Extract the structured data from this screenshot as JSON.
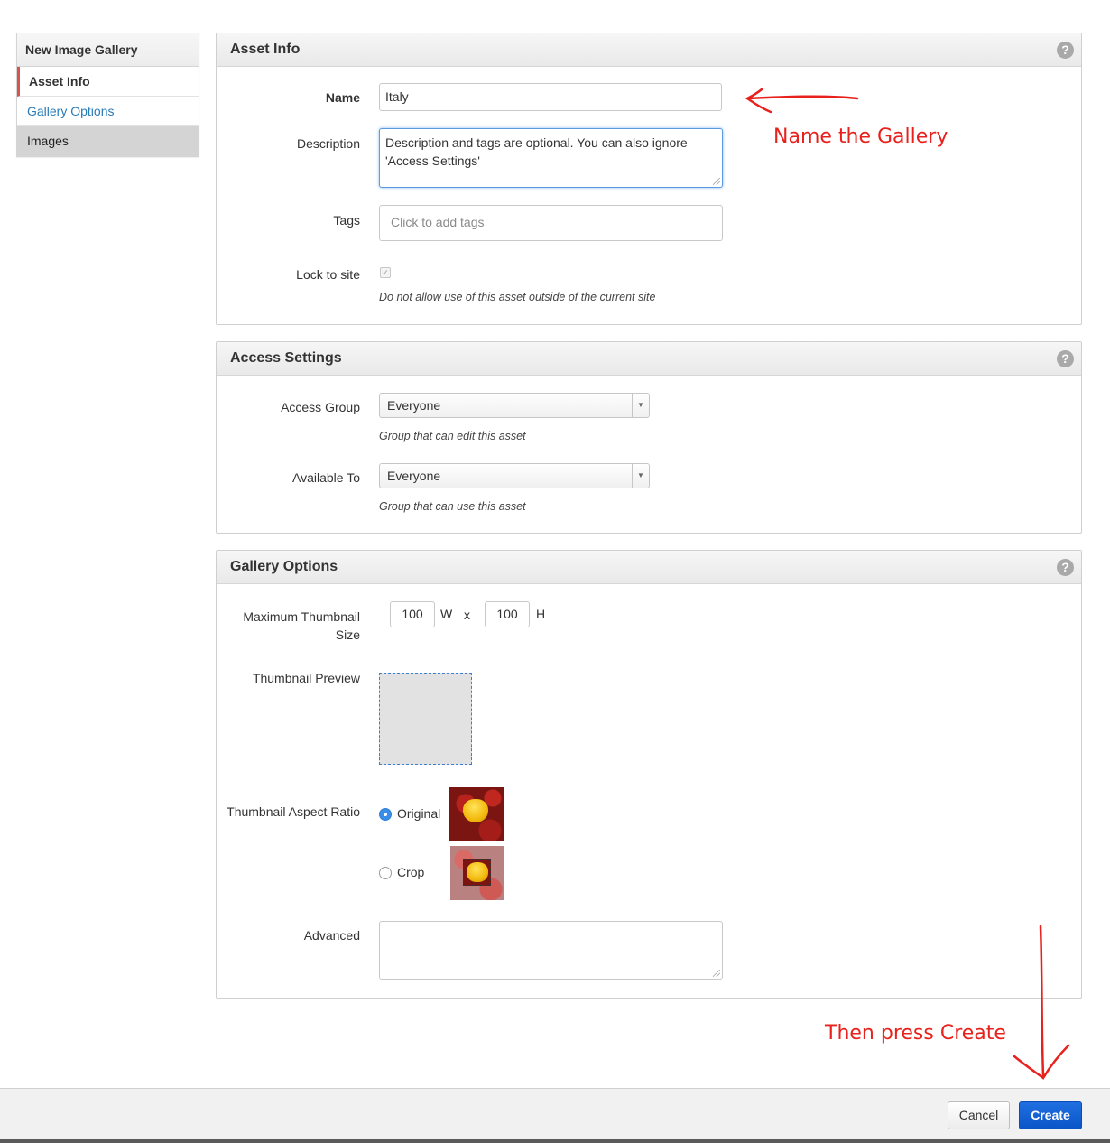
{
  "sidebar": {
    "title": "New Image Gallery",
    "items": [
      {
        "label": "Asset Info"
      },
      {
        "label": "Gallery Options"
      },
      {
        "label": "Images"
      }
    ]
  },
  "asset_info": {
    "title": "Asset Info",
    "help": "?",
    "name_label": "Name",
    "name_value": "Italy",
    "description_label": "Description",
    "description_value": "Description and tags are optional. You can also ignore 'Access Settings'",
    "tags_label": "Tags",
    "tags_placeholder": "Click to add tags",
    "lock_label": "Lock to site",
    "lock_hint": "Do not allow use of this asset outside of the current site"
  },
  "access_settings": {
    "title": "Access Settings",
    "help": "?",
    "access_group_label": "Access Group",
    "access_group_value": "Everyone",
    "access_group_hint": "Group that can edit this asset",
    "available_to_label": "Available To",
    "available_to_value": "Everyone",
    "available_to_hint": "Group that can use this asset"
  },
  "gallery_options": {
    "title": "Gallery Options",
    "help": "?",
    "max_thumb_label_1": "Maximum Thumbnail",
    "max_thumb_label_2": "Size",
    "width_value": "100",
    "width_unit": "W",
    "times": "x",
    "height_value": "100",
    "height_unit": "H",
    "preview_label": "Thumbnail Preview",
    "aspect_label": "Thumbnail Aspect Ratio",
    "original_label": "Original",
    "crop_label": "Crop",
    "advanced_label": "Advanced"
  },
  "annotations": {
    "name_note": "Name the Gallery",
    "create_note": "Then press Create"
  },
  "footer": {
    "cancel": "Cancel",
    "create": "Create"
  },
  "colors": {
    "annotation": "#e8211d",
    "primary_button": "#0b55c9",
    "link": "#2a7ab8",
    "active_marker": "#d9534f"
  }
}
